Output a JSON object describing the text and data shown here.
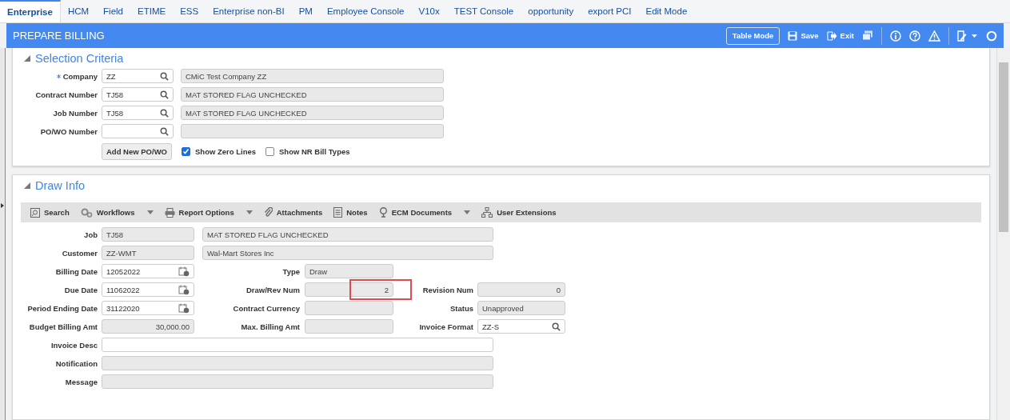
{
  "tabs": [
    {
      "label": "Enterprise",
      "selected": true
    },
    {
      "label": "HCM",
      "selected": false
    },
    {
      "label": "Field",
      "selected": false
    },
    {
      "label": "ETIME",
      "selected": false
    },
    {
      "label": "ESS",
      "selected": false
    },
    {
      "label": "Enterprise non-BI",
      "selected": false
    },
    {
      "label": "PM",
      "selected": false
    },
    {
      "label": "Employee Console",
      "selected": false
    },
    {
      "label": "V10x",
      "selected": false
    },
    {
      "label": "TEST Console",
      "selected": false
    },
    {
      "label": "opportunity",
      "selected": false
    },
    {
      "label": "export PCI",
      "selected": false
    },
    {
      "label": "Edit Mode",
      "selected": false
    }
  ],
  "header": {
    "title": "PREPARE BILLING",
    "mode_button": "Table Mode",
    "save": "Save",
    "exit": "Exit"
  },
  "selection": {
    "title": "Selection Criteria",
    "expanded": true,
    "fields": [
      {
        "label": "Company",
        "required": true,
        "value": "ZZ",
        "description": "CMiC Test Company ZZ"
      },
      {
        "label": "Contract Number",
        "required": false,
        "value": "TJ58",
        "description": "MAT STORED FLAG UNCHECKED"
      },
      {
        "label": "Job Number",
        "required": false,
        "value": "TJ58",
        "description": "MAT STORED FLAG UNCHECKED"
      },
      {
        "label": "PO/WO Number",
        "required": false
      }
    ],
    "add_button": "Add New PO/WO",
    "checkboxes": [
      {
        "label": "Show Zero Lines",
        "checked": true
      },
      {
        "label": "Show NR Bill Types",
        "checked": false
      }
    ]
  },
  "draw_info": {
    "title": "Draw Info",
    "expanded": true,
    "toolbar": [
      {
        "label": "Search",
        "kind": "search",
        "dropdown": false
      },
      {
        "label": "Workflows",
        "kind": "gears",
        "dropdown": true
      },
      {
        "label": "Report Options",
        "kind": "printer",
        "dropdown": true
      },
      {
        "label": "Attachments",
        "kind": "clip",
        "dropdown": false
      },
      {
        "label": "Notes",
        "kind": "notes",
        "dropdown": false
      },
      {
        "label": "ECM Documents",
        "kind": "pin",
        "dropdown": true
      },
      {
        "label": "User Extensions",
        "kind": "tree",
        "dropdown": false
      }
    ],
    "rows": [
      {
        "primary": {
          "label": "Job",
          "value": "TJ58",
          "kind": "readonly"
        },
        "description": {
          "value": "MAT STORED FLAG UNCHECKED"
        }
      },
      {
        "primary": {
          "label": "Customer",
          "value": "ZZ-WMT",
          "kind": "readonly"
        },
        "description": {
          "value": "Wal-Mart Stores Inc"
        }
      },
      {
        "primary": {
          "label": "Billing Date",
          "value": "12052022",
          "kind": "date"
        },
        "middle": {
          "label": "Type",
          "value": "Draw",
          "kind": "readonly"
        }
      },
      {
        "primary": {
          "label": "Due Date",
          "value": "11062022",
          "kind": "date"
        },
        "middle": {
          "label": "Draw/Rev Num",
          "value": "2",
          "kind": "number",
          "highlighted": true
        },
        "right": {
          "label": "Revision Num",
          "value": "0",
          "kind": "number"
        }
      },
      {
        "primary": {
          "label": "Period Ending Date",
          "value": "31122020",
          "kind": "date"
        },
        "middle": {
          "label": "Contract Currency",
          "kind": "readonly"
        },
        "right": {
          "label": "Status",
          "value": "Unapproved",
          "kind": "readonly"
        }
      },
      {
        "primary": {
          "label": "Budget Billing Amt",
          "value": "30,000.00",
          "kind": "number"
        },
        "middle": {
          "label": "Max. Billing Amt",
          "kind": "readonly"
        },
        "right": {
          "label": "Invoice Format",
          "value": "ZZ-S",
          "kind": "lookup"
        }
      },
      {
        "primary": {
          "label": "Invoice Desc",
          "kind": "wide-input"
        }
      },
      {
        "primary": {
          "label": "Notification",
          "kind": "wide-readonly"
        }
      },
      {
        "primary": {
          "label": "Message",
          "kind": "wide-readonly"
        }
      }
    ]
  }
}
